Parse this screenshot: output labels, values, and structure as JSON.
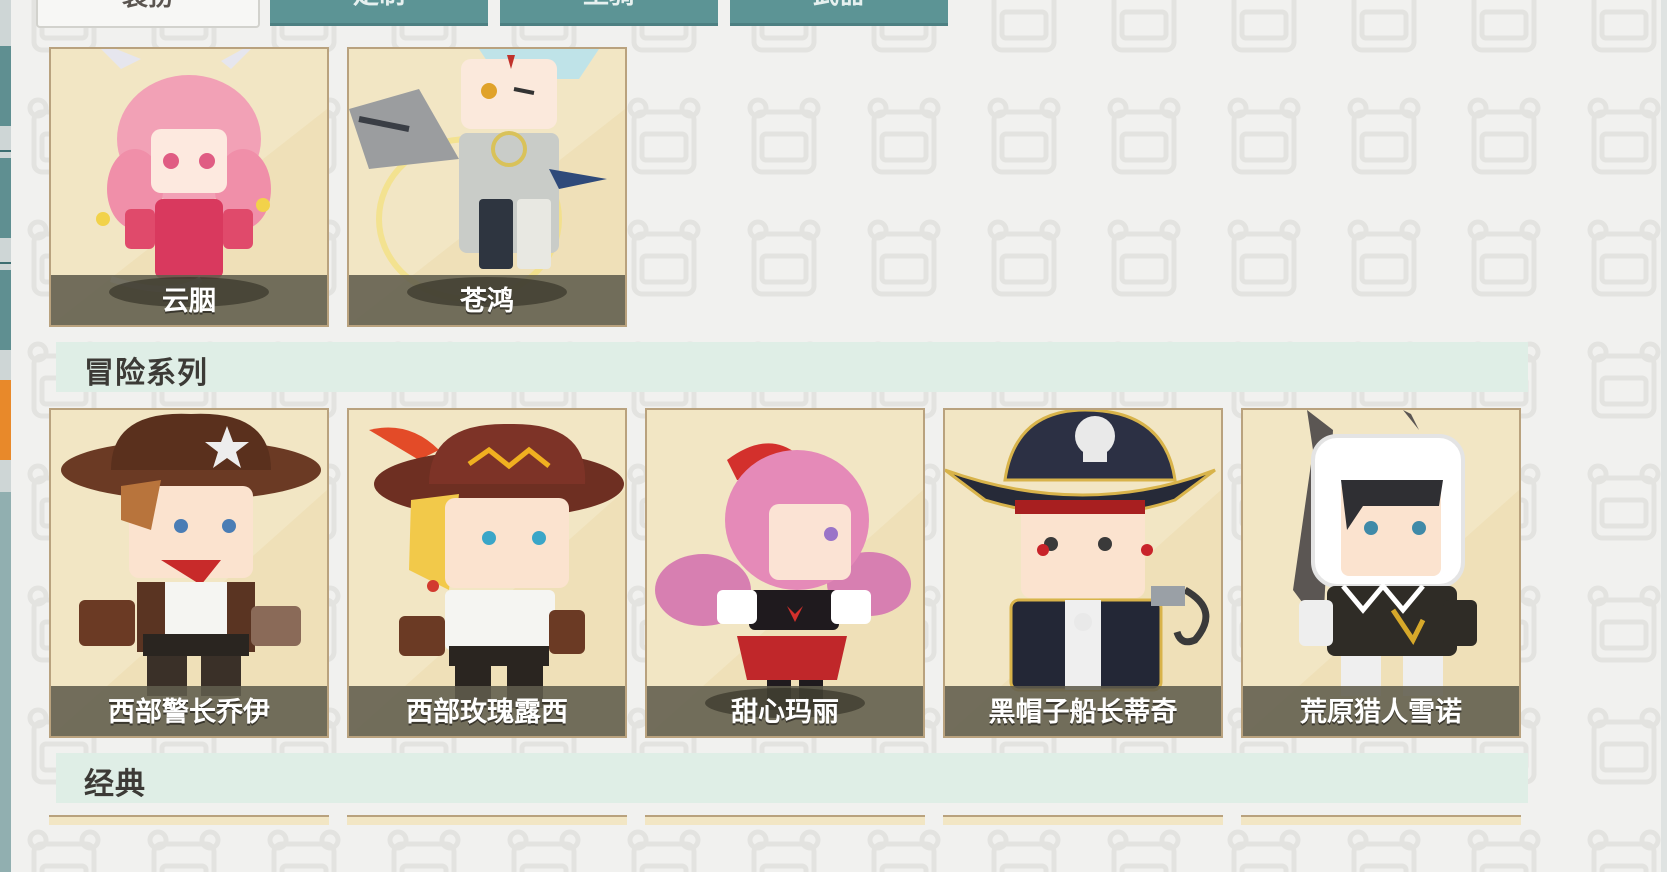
{
  "tabs": [
    {
      "label": "装扮",
      "active": true
    },
    {
      "label": "定制",
      "active": false
    },
    {
      "label": "坐骑",
      "active": false
    },
    {
      "label": "武器",
      "active": false
    }
  ],
  "top_row": [
    {
      "name": "云胭",
      "theme": "pink-bunny-girl"
    },
    {
      "name": "苍鸿",
      "theme": "silver-knight"
    }
  ],
  "sections": [
    {
      "title": "冒险系列",
      "items": [
        {
          "name": "西部警长乔伊",
          "theme": "cowboy-sheriff"
        },
        {
          "name": "西部玫瑰露西",
          "theme": "cowgirl-rose"
        },
        {
          "name": "甜心玛丽",
          "theme": "pink-hair-girl"
        },
        {
          "name": "黑帽子船长蒂奇",
          "theme": "pirate-captain"
        },
        {
          "name": "荒原猎人雪诺",
          "theme": "fur-hunter"
        }
      ]
    },
    {
      "title": "经典",
      "items": []
    }
  ],
  "colors": {
    "tab_active_bg": "#f7f7f5",
    "tab_inactive_bg": "#5c9495",
    "section_header_bg": "#dfeee6",
    "card_bg": "#f2e6c4",
    "card_border": "#b9a27e",
    "name_bar": "#605c4c"
  }
}
